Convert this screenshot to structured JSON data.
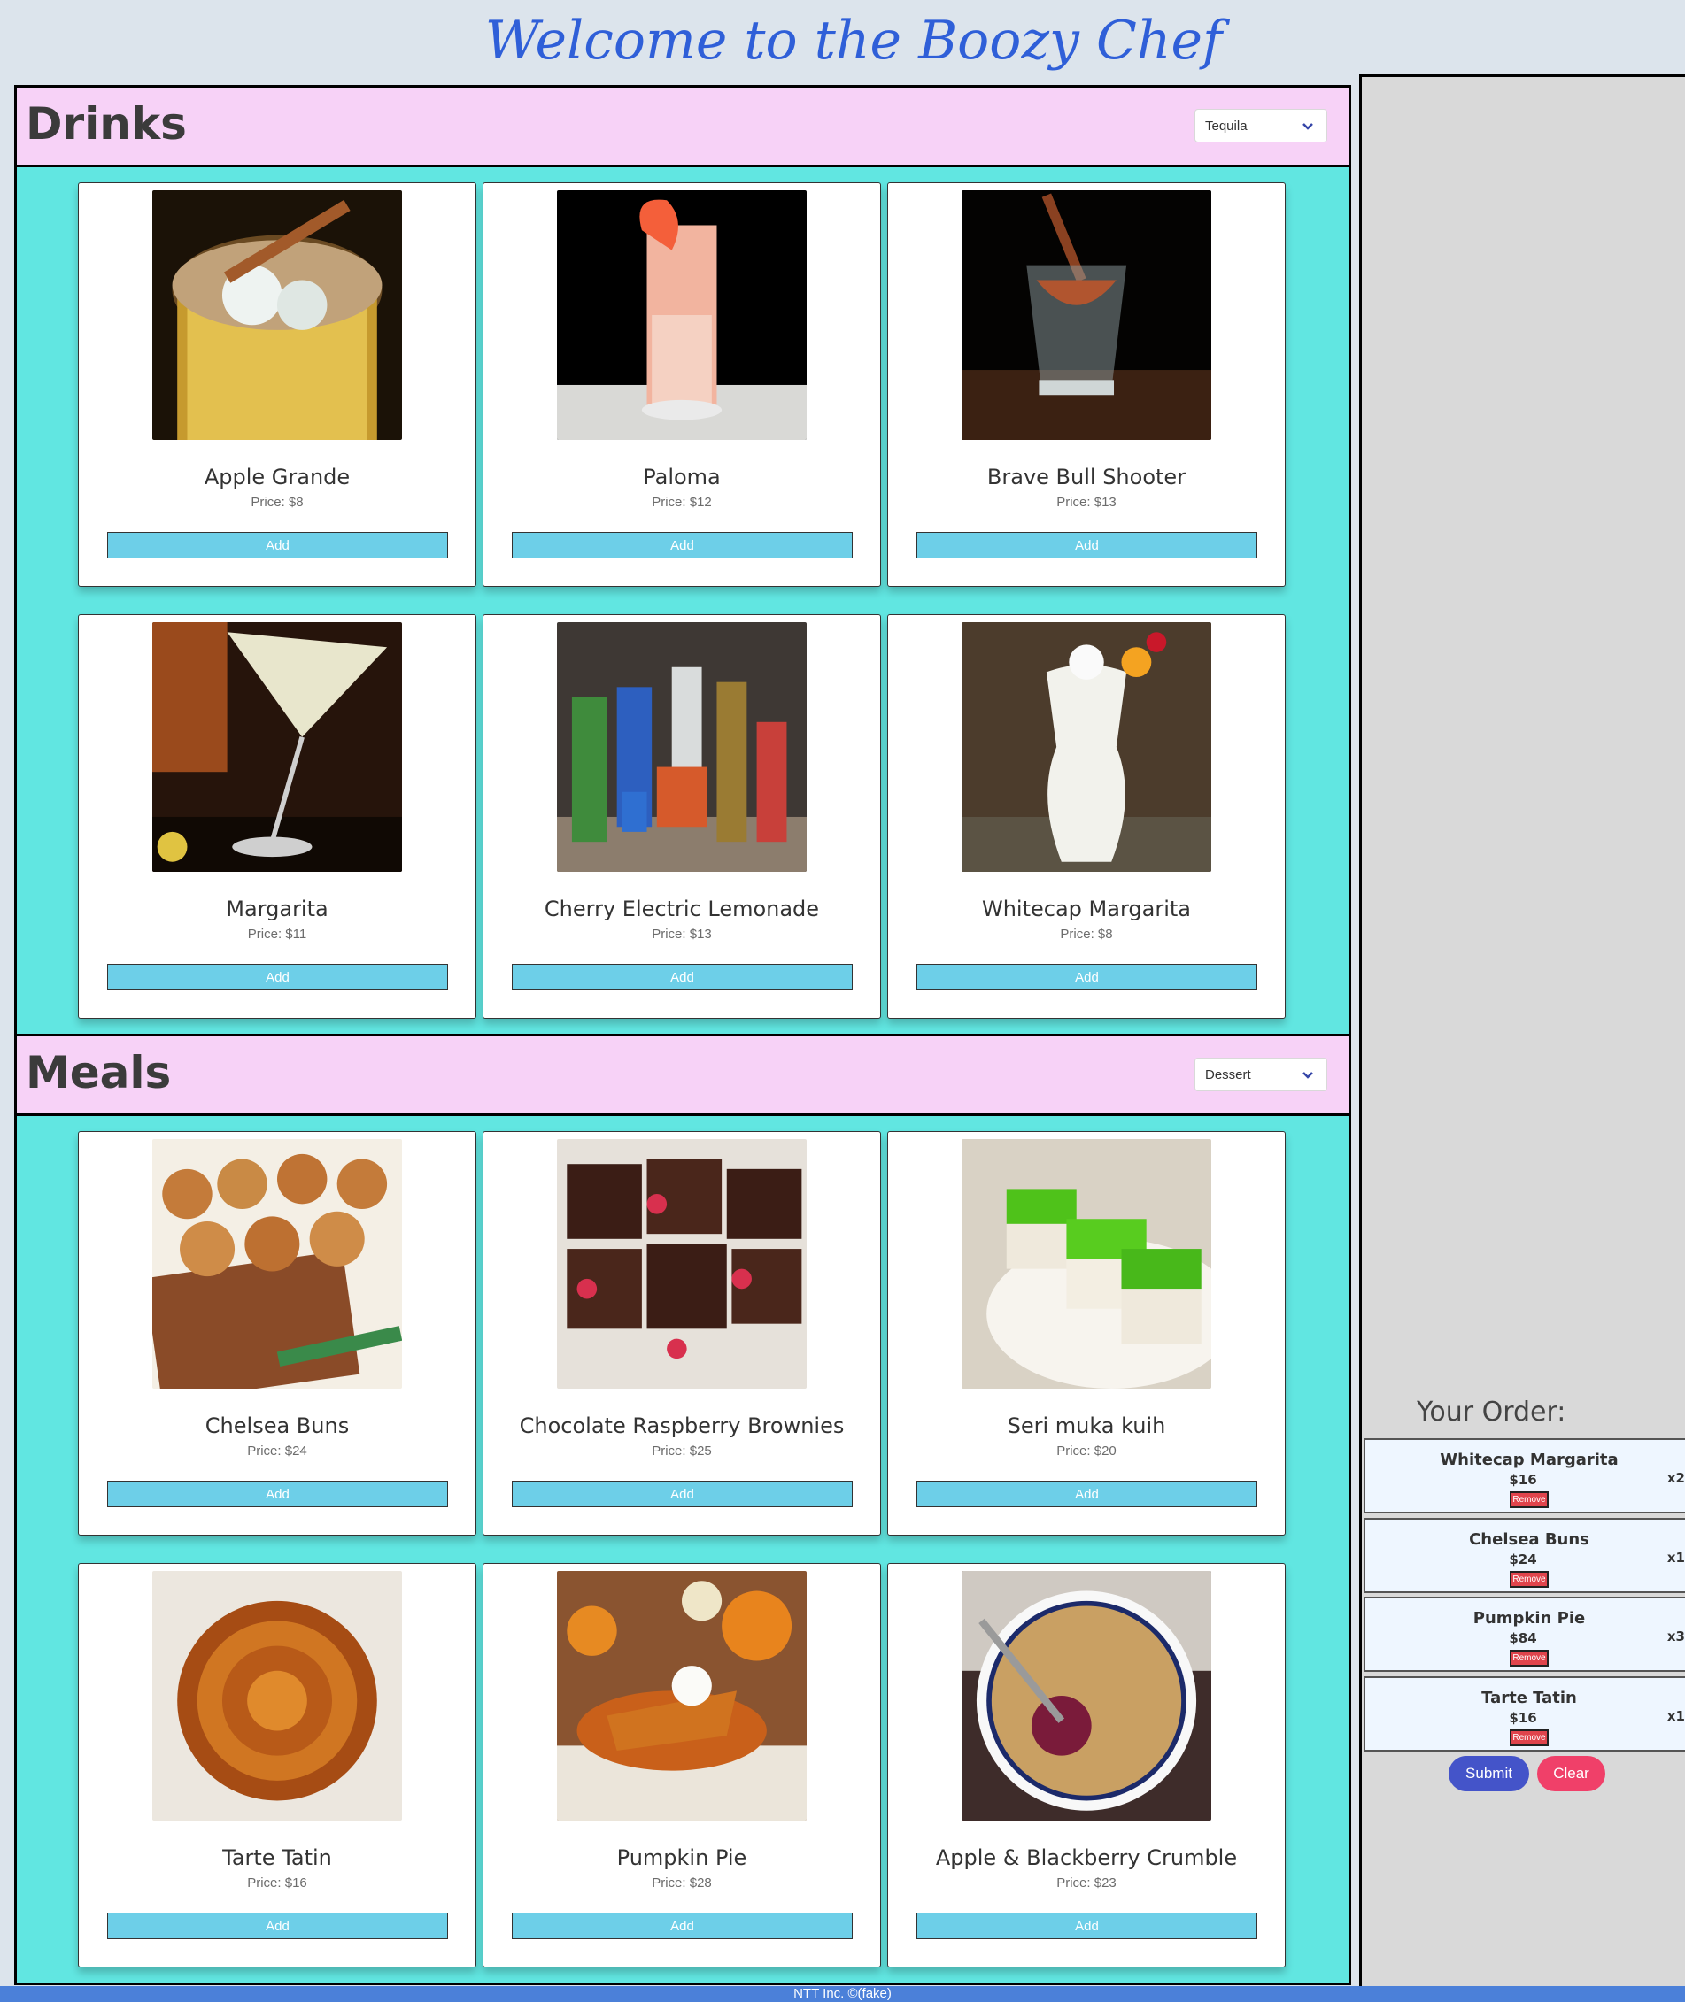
{
  "header": {
    "title": "Welcome to the Boozy Chef"
  },
  "drinks": {
    "title": "Drinks",
    "filter": "Tequila",
    "items": [
      {
        "name": "Apple Grande",
        "price": "Price: $8",
        "add_label": "Add",
        "image": "apple-grande-cocktail-image"
      },
      {
        "name": "Paloma",
        "price": "Price: $12",
        "add_label": "Add",
        "image": "paloma-cocktail-image"
      },
      {
        "name": "Brave Bull Shooter",
        "price": "Price: $13",
        "add_label": "Add",
        "image": "brave-bull-shooter-image"
      },
      {
        "name": "Margarita",
        "price": "Price: $11",
        "add_label": "Add",
        "image": "margarita-image"
      },
      {
        "name": "Cherry Electric Lemonade",
        "price": "Price: $13",
        "add_label": "Add",
        "image": "cherry-electric-lemonade-image"
      },
      {
        "name": "Whitecap Margarita",
        "price": "Price: $8",
        "add_label": "Add",
        "image": "whitecap-margarita-image"
      }
    ]
  },
  "meals": {
    "title": "Meals",
    "filter": "Dessert",
    "items": [
      {
        "name": "Chelsea Buns",
        "price": "Price: $24",
        "add_label": "Add",
        "image": "chelsea-buns-image"
      },
      {
        "name": "Chocolate Raspberry Brownies",
        "price": "Price: $25",
        "add_label": "Add",
        "image": "chocolate-raspberry-brownies-image"
      },
      {
        "name": "Seri muka kuih",
        "price": "Price: $20",
        "add_label": "Add",
        "image": "seri-muka-kuih-image"
      },
      {
        "name": "Tarte Tatin",
        "price": "Price: $16",
        "add_label": "Add",
        "image": "tarte-tatin-image"
      },
      {
        "name": "Pumpkin Pie",
        "price": "Price: $28",
        "add_label": "Add",
        "image": "pumpkin-pie-image"
      },
      {
        "name": "Apple & Blackberry Crumble",
        "price": "Price: $23",
        "add_label": "Add",
        "image": "apple-blackberry-crumble-image"
      }
    ]
  },
  "order": {
    "title": "Your Order:",
    "items": [
      {
        "name": "Whitecap Margarita",
        "total": "$16",
        "qty": "x2",
        "remove_label": "Remove"
      },
      {
        "name": "Chelsea Buns",
        "total": "$24",
        "qty": "x1",
        "remove_label": "Remove"
      },
      {
        "name": "Pumpkin Pie",
        "total": "$84",
        "qty": "x3",
        "remove_label": "Remove"
      },
      {
        "name": "Tarte Tatin",
        "total": "$16",
        "qty": "x1",
        "remove_label": "Remove"
      }
    ],
    "submit_label": "Submit",
    "clear_label": "Clear"
  },
  "footer": {
    "text": "NTT Inc. ©(fake)"
  },
  "colors": {
    "title": "#2f5fd8",
    "section_header": "#f7d2f7",
    "menu_background": "#61e6e1",
    "add_button": "#6dcfe8",
    "submit": "#4454c9",
    "clear": "#f04069",
    "remove": "#e0444c",
    "footer": "#4b80d9"
  }
}
